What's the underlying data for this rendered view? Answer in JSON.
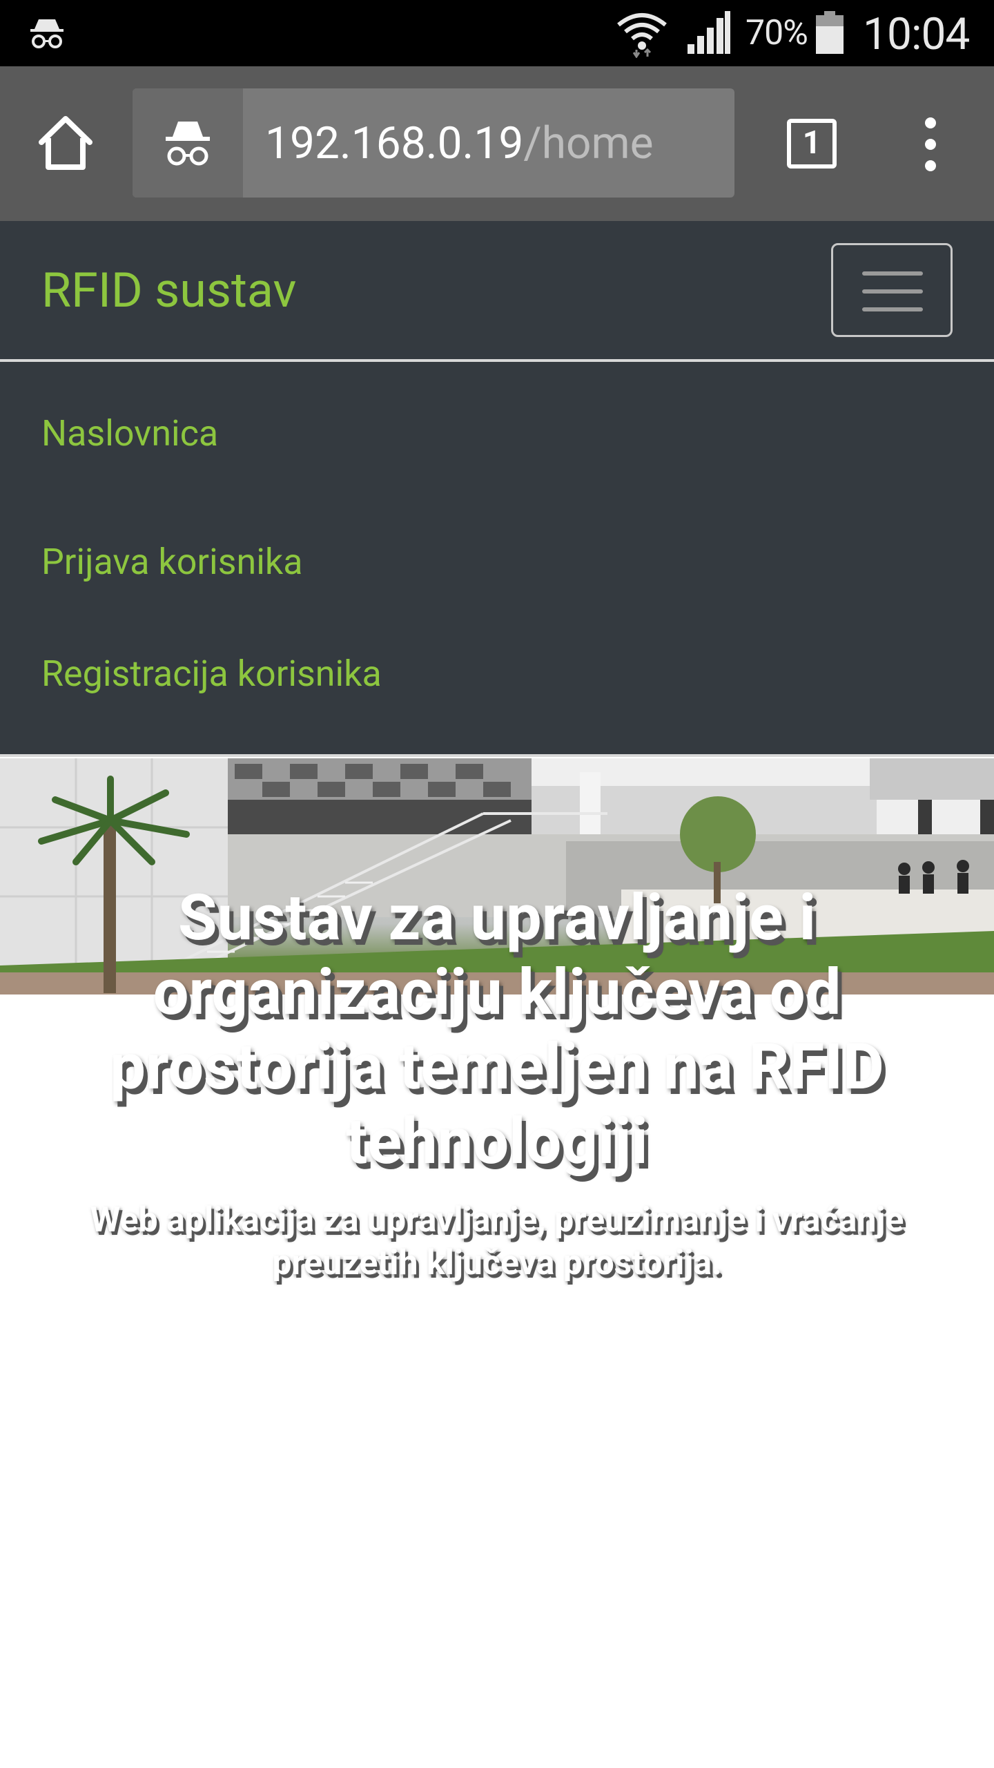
{
  "status_bar": {
    "battery_percent": "70%",
    "time": "10:04",
    "icons": [
      "incognito-icon",
      "wifi-icon",
      "signal-icon",
      "battery-icon"
    ]
  },
  "browser": {
    "url_host": "192.168.0.19",
    "url_path": "/home",
    "tab_count": "1",
    "icons": [
      "home-icon",
      "incognito-icon",
      "tabs-icon",
      "more-vert-icon"
    ]
  },
  "site": {
    "brand": "RFID sustav",
    "nav_links": [
      "Naslovnica",
      "Prijava korisnika",
      "Registracija korisnika"
    ],
    "accent_color": "#8dc63f",
    "navbar_color": "#343a40"
  },
  "hero": {
    "title": "Sustav za upravljanje i organizaciju ključeva od prostorija temeljen na RFID tehnologiji",
    "subtitle": "Web aplikacija za upravljanje, preuzimanje i vraćanje preuzetih ključeva prostorija."
  }
}
